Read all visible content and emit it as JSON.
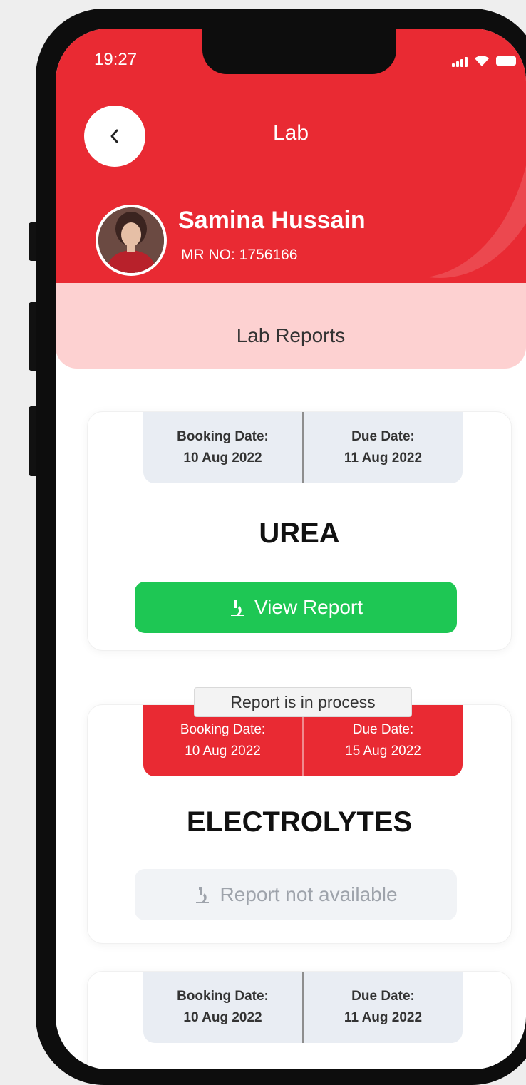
{
  "status_bar": {
    "time": "19:27"
  },
  "header": {
    "title": "Lab",
    "patient_name": "Samina Hussain",
    "mr_number": "MR NO: 1756166"
  },
  "subheader": {
    "title": "Lab Reports"
  },
  "reports": [
    {
      "booking_label": "Booking Date:",
      "booking_date": "10 Aug 2022",
      "due_label": "Due Date:",
      "due_date": "11 Aug 2022",
      "test_name": "UREA",
      "action_label": "View Report",
      "action_icon": "microscope-icon"
    },
    {
      "status_badge": "Report is in process",
      "booking_label": "Booking Date:",
      "booking_date": "10 Aug 2022",
      "due_label": "Due Date:",
      "due_date": "15 Aug 2022",
      "test_name": "ELECTROLYTES",
      "action_label": "Report not available",
      "action_icon": "microscope-icon"
    },
    {
      "booking_label": "Booking Date:",
      "booking_date": "10 Aug 2022",
      "due_label": "Due Date:",
      "due_date": "11 Aug 2022"
    }
  ],
  "colors": {
    "primary_red": "#e92a33",
    "success_green": "#1ec754",
    "light_pink": "#fdd1d1",
    "date_panel_gray": "#e9edf3"
  }
}
